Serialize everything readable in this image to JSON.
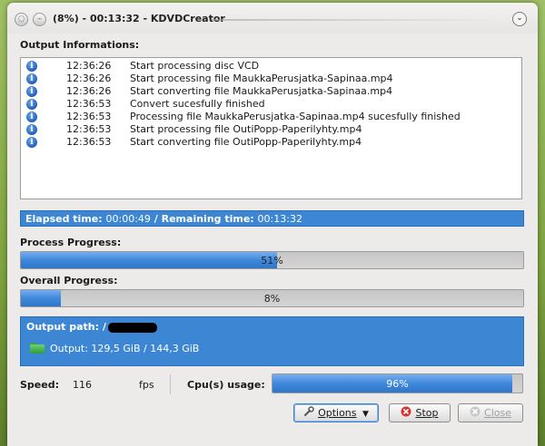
{
  "window": {
    "title": "(8%) - 00:13:32 - KDVDCreator"
  },
  "output_info": {
    "label": "Output Informations:",
    "rows": [
      {
        "time": "12:36:26",
        "message": "Start processing disc VCD"
      },
      {
        "time": "12:36:26",
        "message": "Start processing file MaukkaPerusjatka-Sapinaa.mp4"
      },
      {
        "time": "12:36:26",
        "message": "Start converting file MaukkaPerusjatka-Sapinaa.mp4"
      },
      {
        "time": "12:36:53",
        "message": "Convert sucesfully finished"
      },
      {
        "time": "12:36:53",
        "message": "Processing file MaukkaPerusjatka-Sapinaa.mp4 sucesfully finished"
      },
      {
        "time": "12:36:53",
        "message": "Start processing file OutiPopp-Paperilyhty.mp4"
      },
      {
        "time": "12:36:53",
        "message": "Start converting file OutiPopp-Paperilyhty.mp4"
      }
    ]
  },
  "elapsed": {
    "elapsed_label": "Elapsed time:",
    "elapsed_value": "00:00:49",
    "separator": "/",
    "remaining_label": "Remaining time:",
    "remaining_value": "00:13:32"
  },
  "process_progress": {
    "label": "Process Progress:",
    "percent": 51,
    "text": "51%"
  },
  "overall_progress": {
    "label": "Overall Progress:",
    "percent": 8,
    "text": "8%"
  },
  "output_path": {
    "label": "Output path: /",
    "size_text": "Output: 129,5 GiB / 144,3 GiB"
  },
  "stats": {
    "speed_label": "Speed:",
    "speed_value": "116",
    "speed_unit": "fps",
    "cpu_label": "Cpu(s) usage:",
    "cpu_percent": 96,
    "cpu_text": "96%"
  },
  "buttons": {
    "options": "Options",
    "stop": "Stop",
    "close": "Close"
  },
  "colors": {
    "accent": "#3d86d4",
    "progress_fill": "#3f88db",
    "stop_icon": "#d9322c"
  }
}
